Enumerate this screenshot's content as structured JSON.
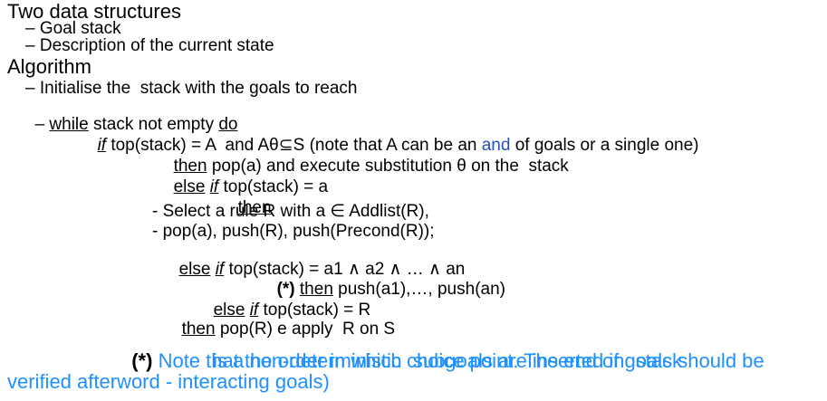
{
  "sections": {
    "data_structures": {
      "title": "Two data structures",
      "items": [
        "– Goal stack",
        "– Description of the current state"
      ]
    },
    "algorithm": {
      "title": "Algorithm",
      "init": "– Initialise the  stack with the goals to reach",
      "while": {
        "dash": "– ",
        "kw": "while",
        "mid": " stack not empty ",
        "do": "do"
      },
      "if1": {
        "kw": "if",
        "text": " top(stack) = A  and Aθ⊆S (note that A can be an ",
        "and": "and",
        "end": " of goals or a single one)"
      },
      "then1": {
        "kw": "then",
        "text": " pop(a) and execute substitution θ on the  stack"
      },
      "else1": {
        "kw": "else",
        "sp": " ",
        "kw2": "if",
        "text": " top(stack) = a"
      },
      "then2": {
        "kw": "then"
      },
      "select": "- Select a rule R with a ∈ Addlist(R),",
      "pop": "- pop(a), push(R), push(Precond(R));",
      "else2": {
        "kw": "else",
        "sp": " ",
        "kw2": "if",
        "text": " top(stack) = a1 ∧ a2 ∧ … ∧ an"
      },
      "then3": {
        "star": "(*)",
        "sp": " ",
        "kw": "then",
        "text": " push(a1),…, push(an)"
      },
      "else3": {
        "kw": "else",
        "sp": " ",
        "kw2": "if",
        "text": " top(stack) = R"
      },
      "then4": {
        "kw": "then",
        "text": " pop(R) e apply  R on S"
      }
    },
    "note": {
      "star": "(*)",
      "line1": " Note that the order in which  subgoals are inserted in  stack",
      "line2": "is a non-deterministic choice point. The end of goals should be",
      "line3": "verified afterword - interacting goals)"
    }
  }
}
